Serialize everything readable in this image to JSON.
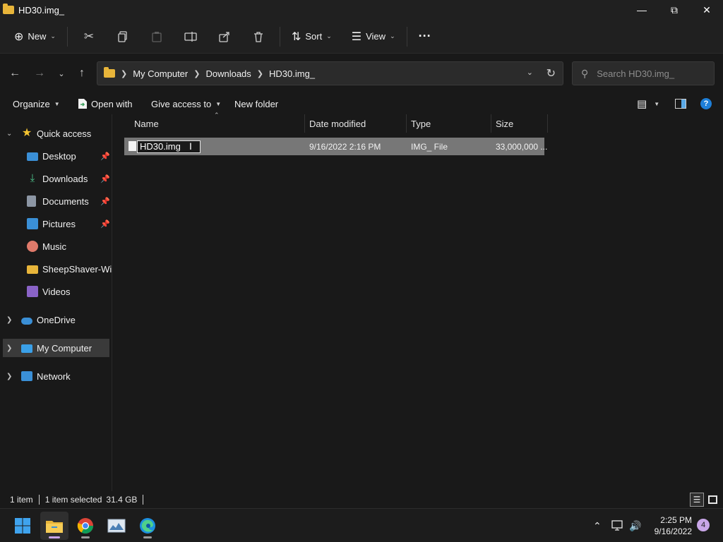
{
  "window": {
    "title": "HD30.img_"
  },
  "cmdbar": {
    "new_label": "New",
    "sort_label": "Sort",
    "view_label": "View",
    "more_label": "···"
  },
  "address": {
    "breadcrumbs": [
      "My Computer",
      "Downloads",
      "HD30.img_"
    ],
    "search_placeholder": "Search HD30.img_"
  },
  "toolbar": {
    "organize": "Organize",
    "open_with": "Open with",
    "give_access": "Give access to",
    "new_folder": "New folder"
  },
  "nav": {
    "quick_access": "Quick access",
    "desktop": "Desktop",
    "downloads": "Downloads",
    "documents": "Documents",
    "pictures": "Pictures",
    "music": "Music",
    "sheepshaver": "SheepShaver-Winc",
    "videos": "Videos",
    "onedrive": "OneDrive",
    "my_computer": "My Computer",
    "network": "Network"
  },
  "columns": {
    "name": "Name",
    "date": "Date modified",
    "type": "Type",
    "size": "Size"
  },
  "files": [
    {
      "name": "HD30.img",
      "date": "9/16/2022 2:16 PM",
      "type": "IMG_ File",
      "size": "33,000,000 ..."
    }
  ],
  "status": {
    "count": "1 item",
    "selected": "1 item selected",
    "size": "31.4 GB"
  },
  "taskbar": {
    "time": "2:25 PM",
    "date": "9/16/2022",
    "notifications": "4"
  }
}
